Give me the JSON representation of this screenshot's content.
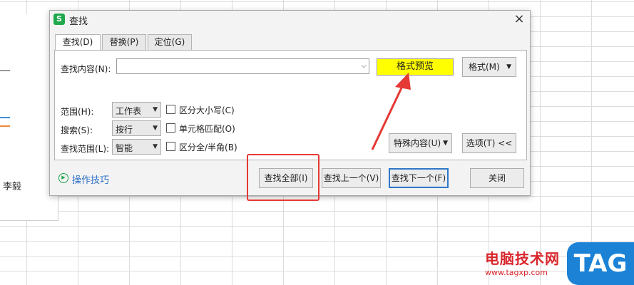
{
  "spreadsheet": {
    "cell_text": "李毅"
  },
  "dialog": {
    "icon_letter": "S",
    "title": "查找",
    "close_glyph": "×",
    "tabs": [
      {
        "label": "查找(D)",
        "active": true
      },
      {
        "label": "替换(P)",
        "active": false
      },
      {
        "label": "定位(G)",
        "active": false
      }
    ],
    "find_label": "查找内容(N):",
    "find_value": "",
    "format_preview": "格式预览",
    "format_button": "格式(M)",
    "scope_label": "范围(H):",
    "scope_value": "工作表",
    "search_label": "搜索(S):",
    "search_value": "按行",
    "lookin_label": "查找范围(L):",
    "lookin_value": "智能",
    "options": [
      {
        "label": "区分大小写(C)",
        "checked": false
      },
      {
        "label": "单元格匹配(O)",
        "checked": false
      },
      {
        "label": "区分全/半角(B)",
        "checked": false
      }
    ],
    "special_button": "特殊内容(U)",
    "options_button": "选项(T) <<",
    "tips_link": "操作技巧",
    "find_all_button": "查找全部(I)",
    "find_prev_button": "查找上一个(V)",
    "find_next_button": "查找下一个(F)",
    "close_button": "关闭"
  },
  "watermark": {
    "cn": "电脑技术网",
    "url": "www.tagxp.com",
    "tag": "TAG"
  },
  "colors": {
    "preview_bg": "#ffff00",
    "annotation": "#e53935",
    "link": "#2b6fc7",
    "app_icon": "#20a84c"
  }
}
